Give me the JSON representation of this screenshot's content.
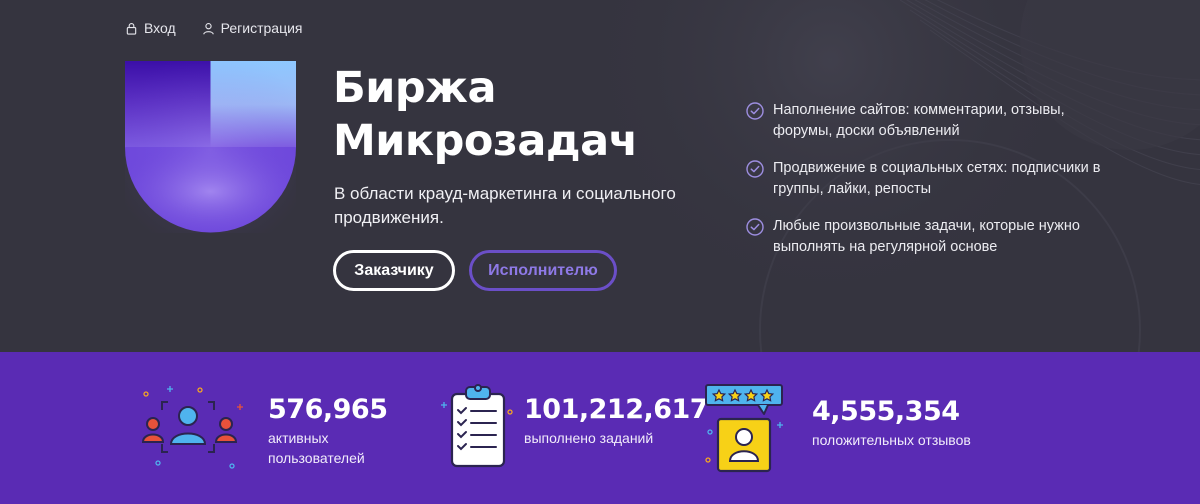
{
  "auth": {
    "login_label": "Вход",
    "register_label": "Регистрация"
  },
  "brand": {
    "title_line1": "Биржа",
    "title_line2": "Микрозадач",
    "subtitle": "В области крауд-маркетинга и социального продвижения."
  },
  "cta": {
    "customer_label": "Заказчику",
    "executor_label": "Исполнителю"
  },
  "features": [
    {
      "text": "Наполнение сайтов: комментарии, отзывы, форумы, доски объявлений",
      "icon": "check-circle-icon"
    },
    {
      "text": "Продвижение в социальных сетях: подписчики в группы, лайки, репосты",
      "icon": "check-circle-icon"
    },
    {
      "text": "Любые произвольные задачи, которые нужно выполнять на регулярной основе",
      "icon": "check-circle-icon"
    }
  ],
  "stats": [
    {
      "value": "576,965",
      "label_line1": "активных",
      "label_line2": "пользователей",
      "icon": "users-icon"
    },
    {
      "value": "101,212,617",
      "label_line1": "выполнено заданий",
      "icon": "clipboard-checklist-icon"
    },
    {
      "value": "4,555,354",
      "label_line1": "положительных отзывов",
      "icon": "rating-review-icon"
    }
  ],
  "colors": {
    "hero_bg": "#35343f",
    "stats_bg": "#5a2bb4",
    "accent": "#6b4fc8"
  }
}
